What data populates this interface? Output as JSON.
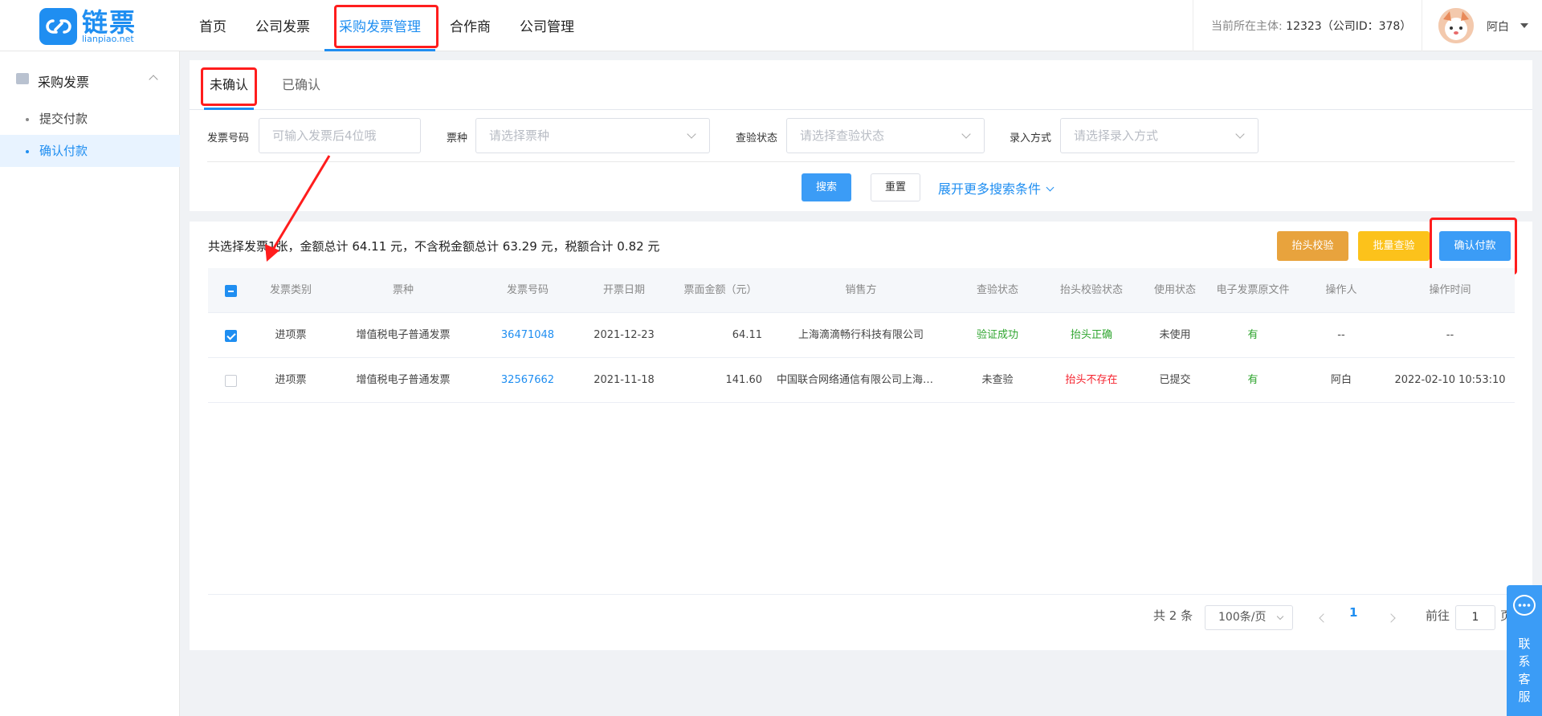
{
  "header": {
    "logo_cn": "链票",
    "logo_en": "lianpiao.net",
    "nav": [
      {
        "label": "首页"
      },
      {
        "label": "公司发票"
      },
      {
        "label": "采购发票管理"
      },
      {
        "label": "合作商"
      },
      {
        "label": "公司管理"
      }
    ],
    "entity_prefix": "当前所在主体:",
    "entity_value": "12323（公司ID：378）",
    "user_name": "阿白"
  },
  "sidebar": {
    "group_label": "采购发票",
    "items": [
      {
        "label": "提交付款"
      },
      {
        "label": "确认付款"
      }
    ]
  },
  "tabs": [
    {
      "label": "未确认"
    },
    {
      "label": "已确认"
    }
  ],
  "filters": {
    "invoice_no_label": "发票号码",
    "invoice_no_placeholder": "可输入发票后4位哦",
    "type_label": "票种",
    "type_placeholder": "请选择票种",
    "check_label": "查验状态",
    "check_placeholder": "请选择查验状态",
    "entry_label": "录入方式",
    "entry_placeholder": "请选择录入方式",
    "search_label": "搜索",
    "reset_label": "重置",
    "more_label": "展开更多搜索条件"
  },
  "summary": "共选择发票1张，金额总计 64.11 元，不含税金额总计 63.29 元，税额合计 0.82 元",
  "actions": {
    "header_check": "抬头校验",
    "batch_check": "批量查验",
    "confirm_pay": "确认付款",
    "header_check_color": "#e8a33d",
    "batch_check_color": "#fcc21b",
    "confirm_pay_color": "#3b9cf6"
  },
  "table": {
    "columns": [
      "发票类别",
      "票种",
      "发票号码",
      "开票日期",
      "票面金额（元）",
      "销售方",
      "查验状态",
      "抬头校验状态",
      "使用状态",
      "电子发票原文件",
      "操作人",
      "操作时间"
    ],
    "rows": [
      {
        "checked": true,
        "category": "进项票",
        "type": "增值税电子普通发票",
        "number": "36471048",
        "date": "2021-12-23",
        "amount": "64.11",
        "seller": "上海滴滴畅行科技有限公司",
        "check_status": "验证成功",
        "header_status": "抬头正确",
        "use_status": "未使用",
        "file": "有",
        "operator": "--",
        "op_time": "--"
      },
      {
        "checked": false,
        "category": "进项票",
        "type": "增值税电子普通发票",
        "number": "32567662",
        "date": "2021-11-18",
        "amount": "141.60",
        "seller": "中国联合网络通信有限公司上海市分公司",
        "check_status": "未查验",
        "header_status": "抬头不存在",
        "use_status": "已提交",
        "file": "有",
        "operator": "阿白",
        "op_time": "2022-02-10 10:53:10"
      }
    ]
  },
  "pagination": {
    "total": "共 2 条",
    "page_size": "100条/页",
    "current": "1",
    "goto_label": "前往",
    "goto_value": "1",
    "page_suffix": "页"
  },
  "service": {
    "label": "联系客服"
  }
}
